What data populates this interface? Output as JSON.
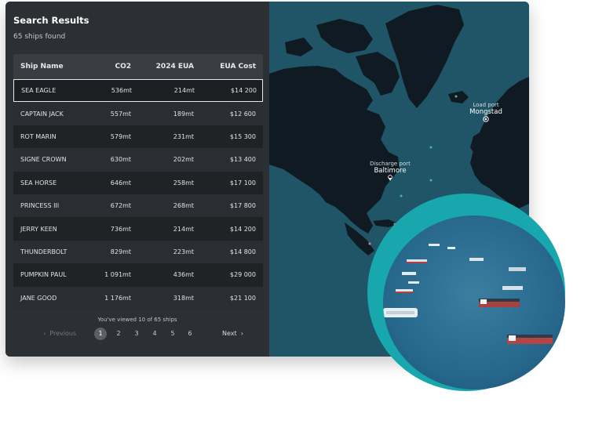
{
  "panel": {
    "title": "Search Results",
    "count_text": "65 ships found",
    "columns": [
      "Ship Name",
      "CO2",
      "2024 EUA",
      "EUA Cost"
    ],
    "rows": [
      {
        "name": "SEA EAGLE",
        "co2": "536mt",
        "eua": "214mt",
        "cost": "$14 200",
        "selected": true
      },
      {
        "name": "CAPTAIN JACK",
        "co2": "557mt",
        "eua": "189mt",
        "cost": "$12 600"
      },
      {
        "name": "ROT MARIN",
        "co2": "579mt",
        "eua": "231mt",
        "cost": "$15 300"
      },
      {
        "name": "SIGNE CROWN",
        "co2": "630mt",
        "eua": "202mt",
        "cost": "$13 400"
      },
      {
        "name": "SEA HORSE",
        "co2": "646mt",
        "eua": "258mt",
        "cost": "$17 100"
      },
      {
        "name": "PRINCESS III",
        "co2": "672mt",
        "eua": "268mt",
        "cost": "$17 800"
      },
      {
        "name": "JERRY KEEN",
        "co2": "736mt",
        "eua": "214mt",
        "cost": "$14 200"
      },
      {
        "name": "THUNDERBOLT",
        "co2": "829mt",
        "eua": "223mt",
        "cost": "$14 800"
      },
      {
        "name": "PUMPKIN PAUL",
        "co2": "1 091mt",
        "eua": "436mt",
        "cost": "$29 000"
      },
      {
        "name": "JANE GOOD",
        "co2": "1 176mt",
        "eua": "318mt",
        "cost": "$21 100"
      }
    ],
    "viewed_text": "You've viewed 10 of 65 ships",
    "pagination": {
      "previous": "Previous",
      "next": "Next",
      "pages": [
        "1",
        "2",
        "3",
        "4",
        "5",
        "6"
      ],
      "active_page": "1"
    }
  },
  "map": {
    "load_port": {
      "label": "Load port",
      "name": "Mongstad"
    },
    "discharge_port": {
      "label": "Discharge port",
      "name": "Baltimore"
    }
  },
  "icons": {
    "prev": "chevron-left-icon",
    "next": "chevron-right-icon",
    "load_port_marker": "target-icon",
    "discharge_port_marker": "map-pin-icon"
  },
  "colors": {
    "panel_bg": "#2c2f34",
    "map_ocean": "#1f5567",
    "map_land": "#0f1a22",
    "accent_teal": "#17a7ad"
  }
}
